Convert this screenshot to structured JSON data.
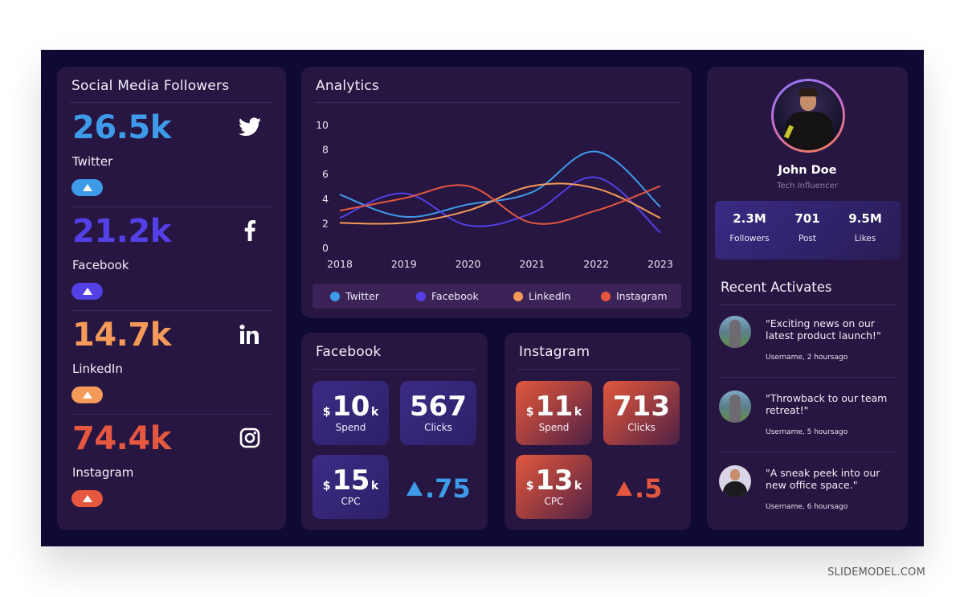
{
  "watermark": "SLIDEMODEL.COM",
  "followers": {
    "title": "Social Media Followers",
    "items": [
      {
        "value": "26.5k",
        "label": "Twitter",
        "color": "#3e9be9",
        "icon": "twitter-icon",
        "trend": "up"
      },
      {
        "value": "21.2k",
        "label": "Facebook",
        "color": "#5340e6",
        "icon": "facebook-icon",
        "trend": "up"
      },
      {
        "value": "14.7k",
        "label": "LinkedIn",
        "color": "#f59a58",
        "icon": "linkedin-icon",
        "trend": "up"
      },
      {
        "value": "74.4k",
        "label": "Instagram",
        "color": "#e5573f",
        "icon": "instagram-icon",
        "trend": "up"
      }
    ]
  },
  "analytics": {
    "title": "Analytics"
  },
  "chart_data": {
    "type": "line",
    "title": "Analytics",
    "xlabel": "",
    "ylabel": "",
    "x": [
      "2018",
      "2019",
      "2020",
      "2021",
      "2022",
      "2023"
    ],
    "yticks": [
      "0",
      "2",
      "4",
      "6",
      "8",
      "10"
    ],
    "ylim": [
      0,
      10
    ],
    "grid": false,
    "smooth": true,
    "legend_position": "bottom",
    "series": [
      {
        "name": "Twitter",
        "color": "#3e9be9",
        "values": [
          4.3,
          2.5,
          3.5,
          4.5,
          7.8,
          3.3
        ]
      },
      {
        "name": "Facebook",
        "color": "#5340e6",
        "values": [
          2.4,
          4.4,
          1.8,
          2.8,
          5.7,
          1.2
        ]
      },
      {
        "name": "LinkedIn",
        "color": "#f59a58",
        "values": [
          2.0,
          2.0,
          3.0,
          5.0,
          4.8,
          2.4
        ]
      },
      {
        "name": "Instagram",
        "color": "#e5573f",
        "values": [
          3.0,
          4.0,
          5.0,
          2.0,
          3.0,
          5.0
        ]
      }
    ]
  },
  "facebook_ads": {
    "title": "Facebook",
    "spend": {
      "currency": "$",
      "value": "10",
      "unit": "k",
      "label": "Spend"
    },
    "clicks": {
      "value": "567",
      "label": "Clicks"
    },
    "cpc": {
      "currency": "$",
      "value": "15",
      "unit": "k",
      "label": "CPC"
    },
    "delta": {
      "value": ".75",
      "direction": "up",
      "color": "#3e9be9"
    }
  },
  "instagram_ads": {
    "title": "Instagram",
    "spend": {
      "currency": "$",
      "value": "11",
      "unit": "k",
      "label": "Spend"
    },
    "clicks": {
      "value": "713",
      "label": "Clicks"
    },
    "cpc": {
      "currency": "$",
      "value": "13",
      "unit": "k",
      "label": "CPC"
    },
    "delta": {
      "value": ".5",
      "direction": "up",
      "color": "#e5573f"
    }
  },
  "profile": {
    "name": "John Doe",
    "role": "Tech Influencer",
    "stats": [
      {
        "value": "2.3M",
        "label": "Followers"
      },
      {
        "value": "701",
        "label": "Post"
      },
      {
        "value": "9.5M",
        "label": "Likes"
      }
    ],
    "activity_title": "Recent Activates",
    "activities": [
      {
        "text": "\"Exciting news on our latest product launch!\"",
        "meta": "Username, 2 hoursago",
        "avatar": "woman"
      },
      {
        "text": "\"Throwback to our team retreat!\"",
        "meta": "Username, 5 hoursago",
        "avatar": "woman"
      },
      {
        "text": "\"A sneak peek into our new office space.\"",
        "meta": "Username, 6 hoursago",
        "avatar": "man"
      }
    ]
  }
}
